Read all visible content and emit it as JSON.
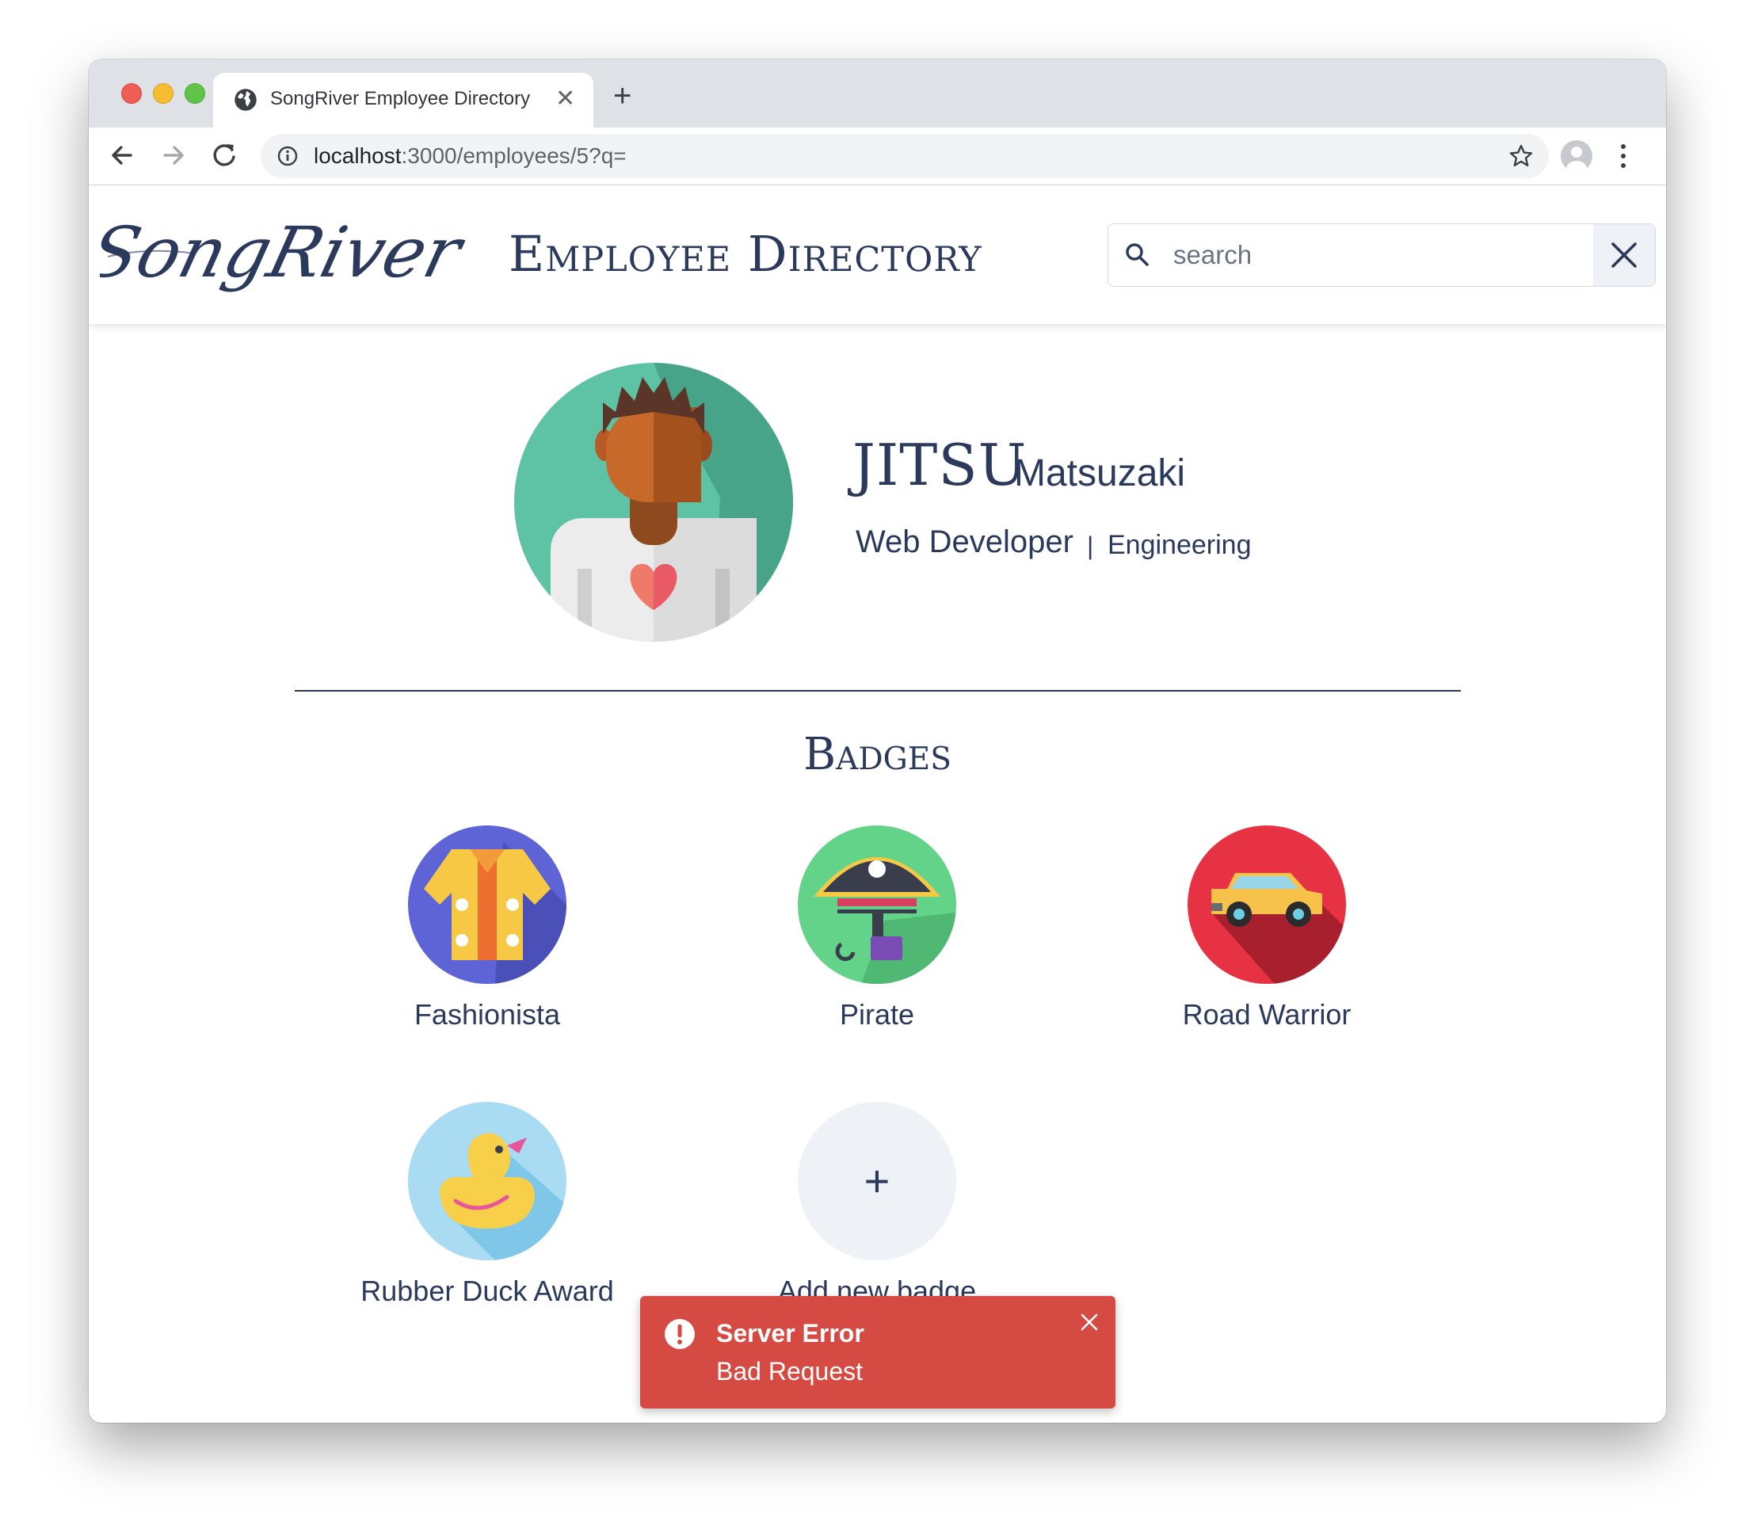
{
  "browser": {
    "tab_title": "SongRiver Employee Directory",
    "tab_close": "✕",
    "new_tab": "+",
    "url_host": "localhost",
    "url_path": ":3000/employees/5?q="
  },
  "app": {
    "logo_text": "SongRiver",
    "title": "Employee Directory",
    "search_placeholder": "search"
  },
  "employee": {
    "first_name": "JITSU",
    "last_name": "Matsuzaki",
    "job_title": "Web Developer",
    "separator": "|",
    "department": "Engineering"
  },
  "badges": {
    "heading": "Badges",
    "items": [
      {
        "label": "Fashionista",
        "icon": "hawaiian-shirt-icon",
        "color": "#5e63d6"
      },
      {
        "label": "Pirate",
        "icon": "pirate-icon",
        "color": "#62d388"
      },
      {
        "label": "Road Warrior",
        "icon": "car-icon",
        "color": "#e63243"
      },
      {
        "label": "Rubber Duck Award",
        "icon": "rubber-duck-icon",
        "color": "#a9dcf2"
      }
    ],
    "add_symbol": "+",
    "add_label": "Add new badge"
  },
  "toast": {
    "title": "Server Error",
    "message": "Bad Request",
    "color": "#d64a44"
  }
}
